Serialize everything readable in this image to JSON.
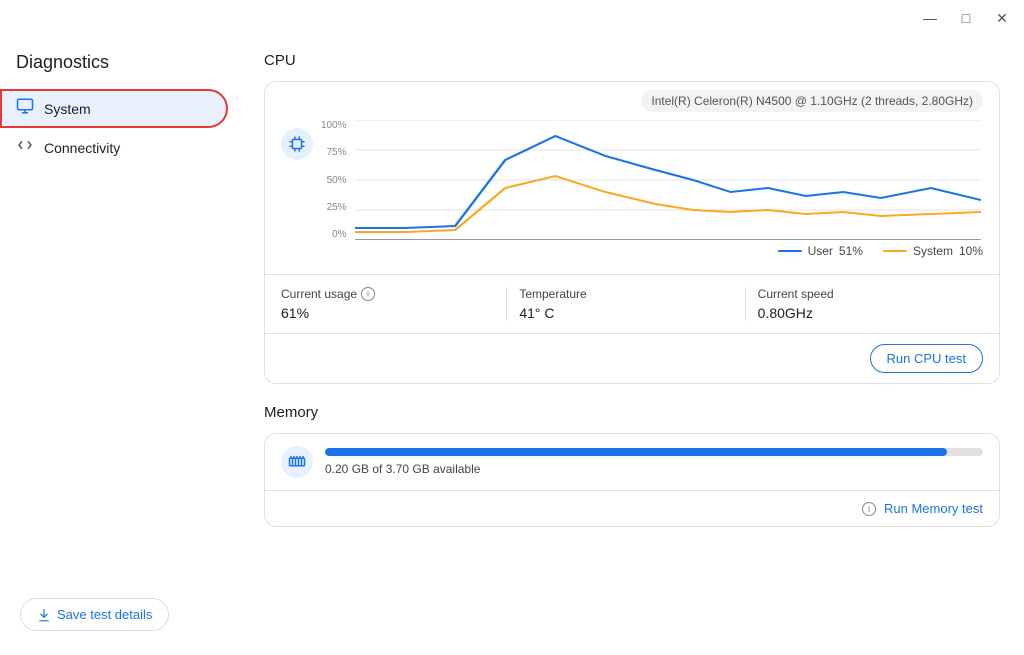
{
  "window": {
    "title": "Diagnostics",
    "controls": {
      "minimize": "—",
      "maximize": "□",
      "close": "✕"
    }
  },
  "sidebar": {
    "title": "Diagnostics",
    "items": [
      {
        "id": "system",
        "label": "System",
        "icon": "monitor",
        "active": true
      },
      {
        "id": "connectivity",
        "label": "Connectivity",
        "icon": "arrows",
        "active": false
      }
    ]
  },
  "cpu": {
    "section_title": "CPU",
    "chip_info": "Intel(R) Celeron(R) N4500 @ 1.10GHz (2 threads, 2.80GHz)",
    "chart": {
      "y_labels": [
        "100%",
        "75%",
        "50%",
        "25%",
        "0%"
      ],
      "user_color": "#1a73e8",
      "system_color": "#f9a825",
      "user_label": "User",
      "user_value": "51%",
      "system_label": "System",
      "system_value": "10%"
    },
    "stats": {
      "current_usage_label": "Current usage",
      "current_usage_value": "61%",
      "temperature_label": "Temperature",
      "temperature_value": "41° C",
      "current_speed_label": "Current speed",
      "current_speed_value": "0.80GHz"
    },
    "run_test_label": "Run CPU test"
  },
  "memory": {
    "section_title": "Memory",
    "bar_fill_pct": 94.6,
    "available_label": "0.20 GB of 3.70 GB available",
    "run_test_label": "Run Memory test",
    "info_icon_label": "info"
  },
  "footer": {
    "save_label": "Save test details"
  }
}
